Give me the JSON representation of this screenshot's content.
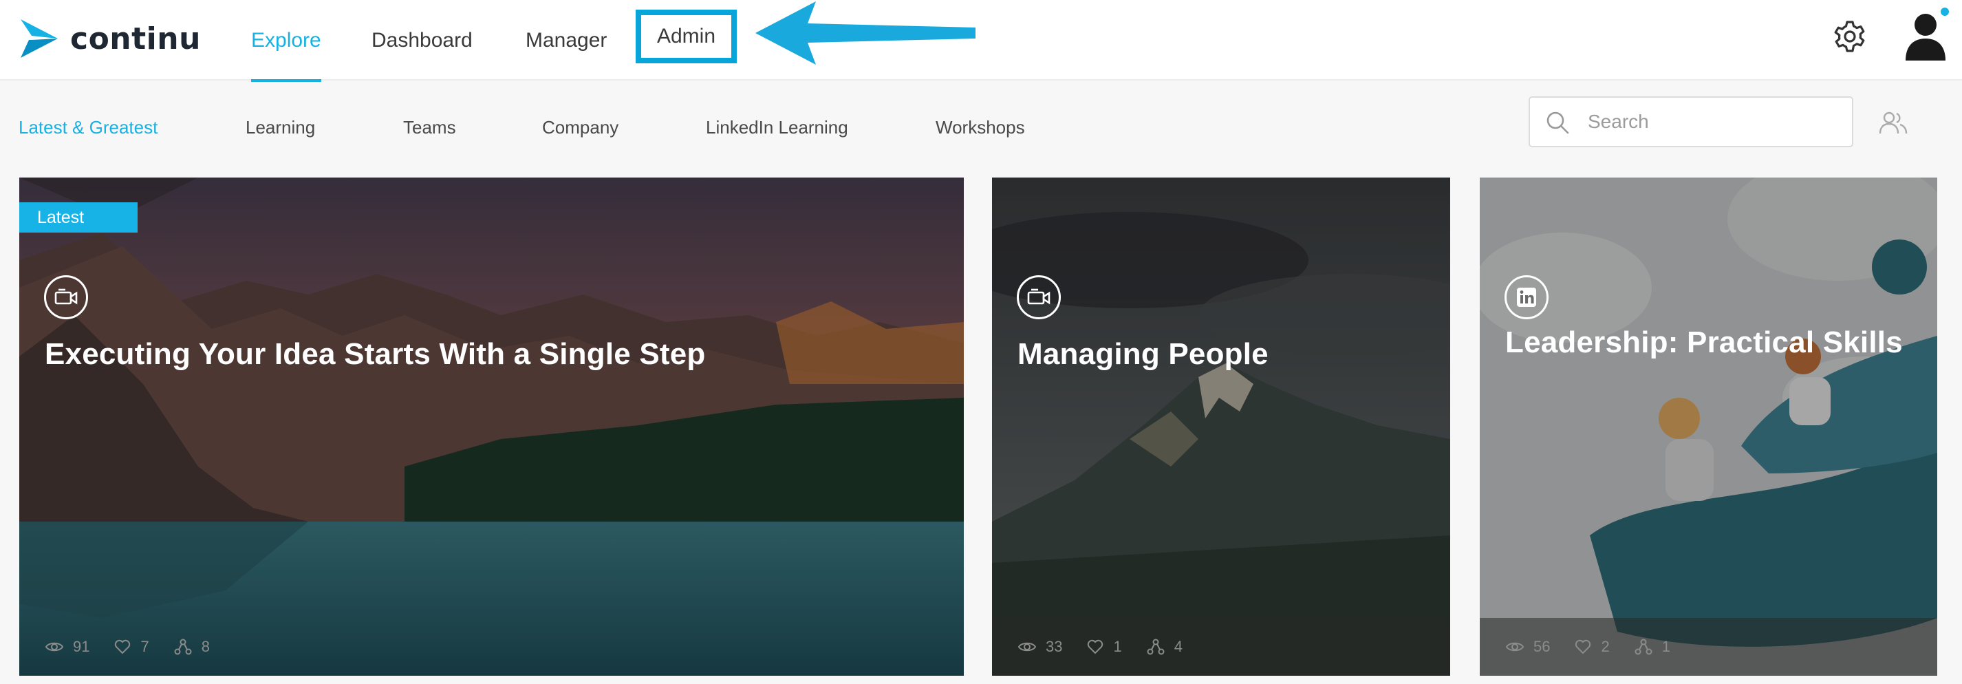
{
  "brand": {
    "name": "continu",
    "accent_color": "#16b2e4",
    "callout_color": "#08a5da"
  },
  "top_nav": {
    "explore": "Explore",
    "dashboard": "Dashboard",
    "manager": "Manager",
    "admin": "Admin",
    "active": "Explore"
  },
  "top_right": {
    "settings_icon": "gear-icon",
    "profile_icon": "user-avatar-icon",
    "notification": true
  },
  "sub_nav": {
    "items": [
      "Latest & Greatest",
      "Learning",
      "Teams",
      "Company",
      "LinkedIn Learning",
      "Workshops"
    ],
    "active": "Latest & Greatest"
  },
  "search": {
    "placeholder": "Search",
    "value": ""
  },
  "cards": [
    {
      "badge": "Latest",
      "type_icon": "video-icon",
      "title": "Executing Your Idea Starts With a Single Step",
      "views": "91",
      "likes": "7",
      "shares": "8"
    },
    {
      "type_icon": "video-icon",
      "title": "Managing People",
      "views": "33",
      "likes": "1",
      "shares": "4"
    },
    {
      "type_icon": "linkedin-icon",
      "title": "Leadership: Practical Skills",
      "views": "56",
      "likes": "2",
      "shares": "1"
    }
  ]
}
